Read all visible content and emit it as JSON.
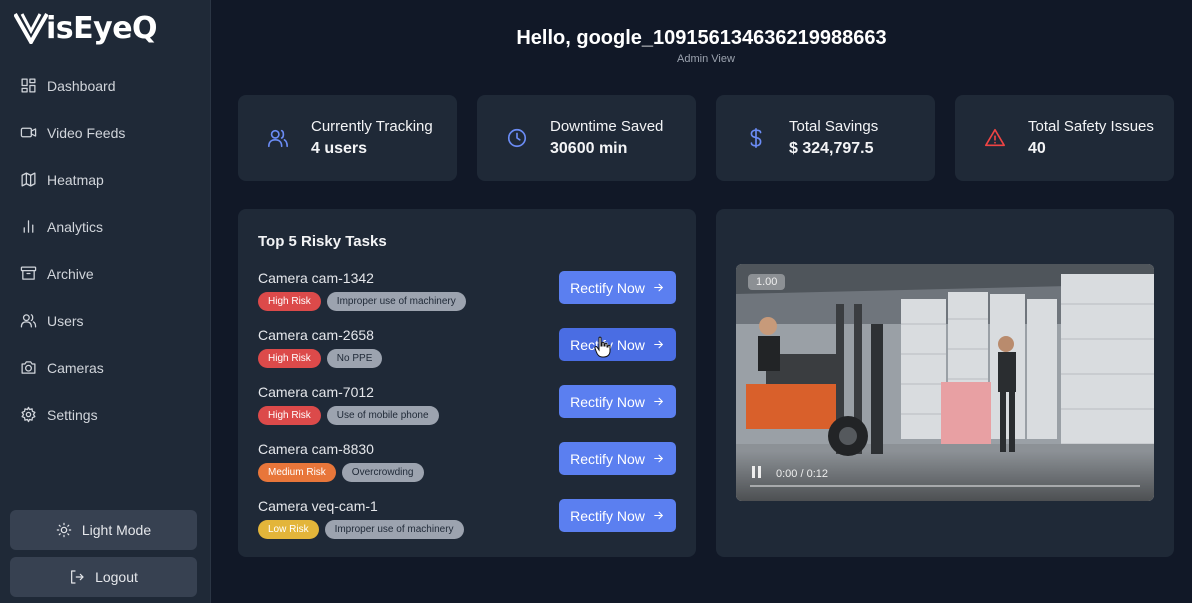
{
  "app": {
    "name": "VisEyeQ",
    "logo_text": "isEyeQ"
  },
  "sidebar": {
    "items": [
      {
        "label": "Dashboard",
        "icon": "dashboard-icon"
      },
      {
        "label": "Video Feeds",
        "icon": "video-icon"
      },
      {
        "label": "Heatmap",
        "icon": "map-icon"
      },
      {
        "label": "Analytics",
        "icon": "bar-chart-icon"
      },
      {
        "label": "Archive",
        "icon": "archive-icon"
      },
      {
        "label": "Users",
        "icon": "users-icon"
      },
      {
        "label": "Cameras",
        "icon": "camera-icon"
      },
      {
        "label": "Settings",
        "icon": "gear-icon"
      }
    ],
    "light_mode_label": "Light Mode",
    "logout_label": "Logout"
  },
  "header": {
    "greeting": "Hello, google_109156134636219988663",
    "subtitle": "Admin View"
  },
  "stats": [
    {
      "label": "Currently Tracking",
      "value": "4 users",
      "icon": "users-icon",
      "color": "#6b8cf5"
    },
    {
      "label": "Downtime Saved",
      "value": "30600 min",
      "icon": "clock-icon",
      "color": "#6b8cf5"
    },
    {
      "label": "Total Savings",
      "value": "$ 324,797.5",
      "icon": "dollar-icon",
      "color": "#6b8cf5"
    },
    {
      "label": "Total Safety Issues",
      "value": "40",
      "icon": "warning-icon",
      "color": "#ef4444"
    }
  ],
  "tasks": {
    "title": "Top 5 Risky Tasks",
    "button_label": "Rectify Now",
    "items": [
      {
        "camera": "Camera cam-1342",
        "risk": "High Risk",
        "risk_color": "#dc4a4a",
        "issue": "Improper use of machinery"
      },
      {
        "camera": "Camera cam-2658",
        "risk": "High Risk",
        "risk_color": "#dc4a4a",
        "issue": "No PPE"
      },
      {
        "camera": "Camera cam-7012",
        "risk": "High Risk",
        "risk_color": "#dc4a4a",
        "issue": "Use of mobile phone"
      },
      {
        "camera": "Camera cam-8830",
        "risk": "Medium Risk",
        "risk_color": "#e8763a",
        "issue": "Overcrowding"
      },
      {
        "camera": "Camera veq-cam-1",
        "risk": "Low Risk",
        "risk_color": "#e3b53a",
        "issue": "Improper use of machinery"
      }
    ]
  },
  "video": {
    "speed": "1.00",
    "time": "0:00 / 0:12",
    "progress": 0
  },
  "colors": {
    "background": "#111827",
    "panel": "#1f2937",
    "accent": "#5b7ff0"
  }
}
